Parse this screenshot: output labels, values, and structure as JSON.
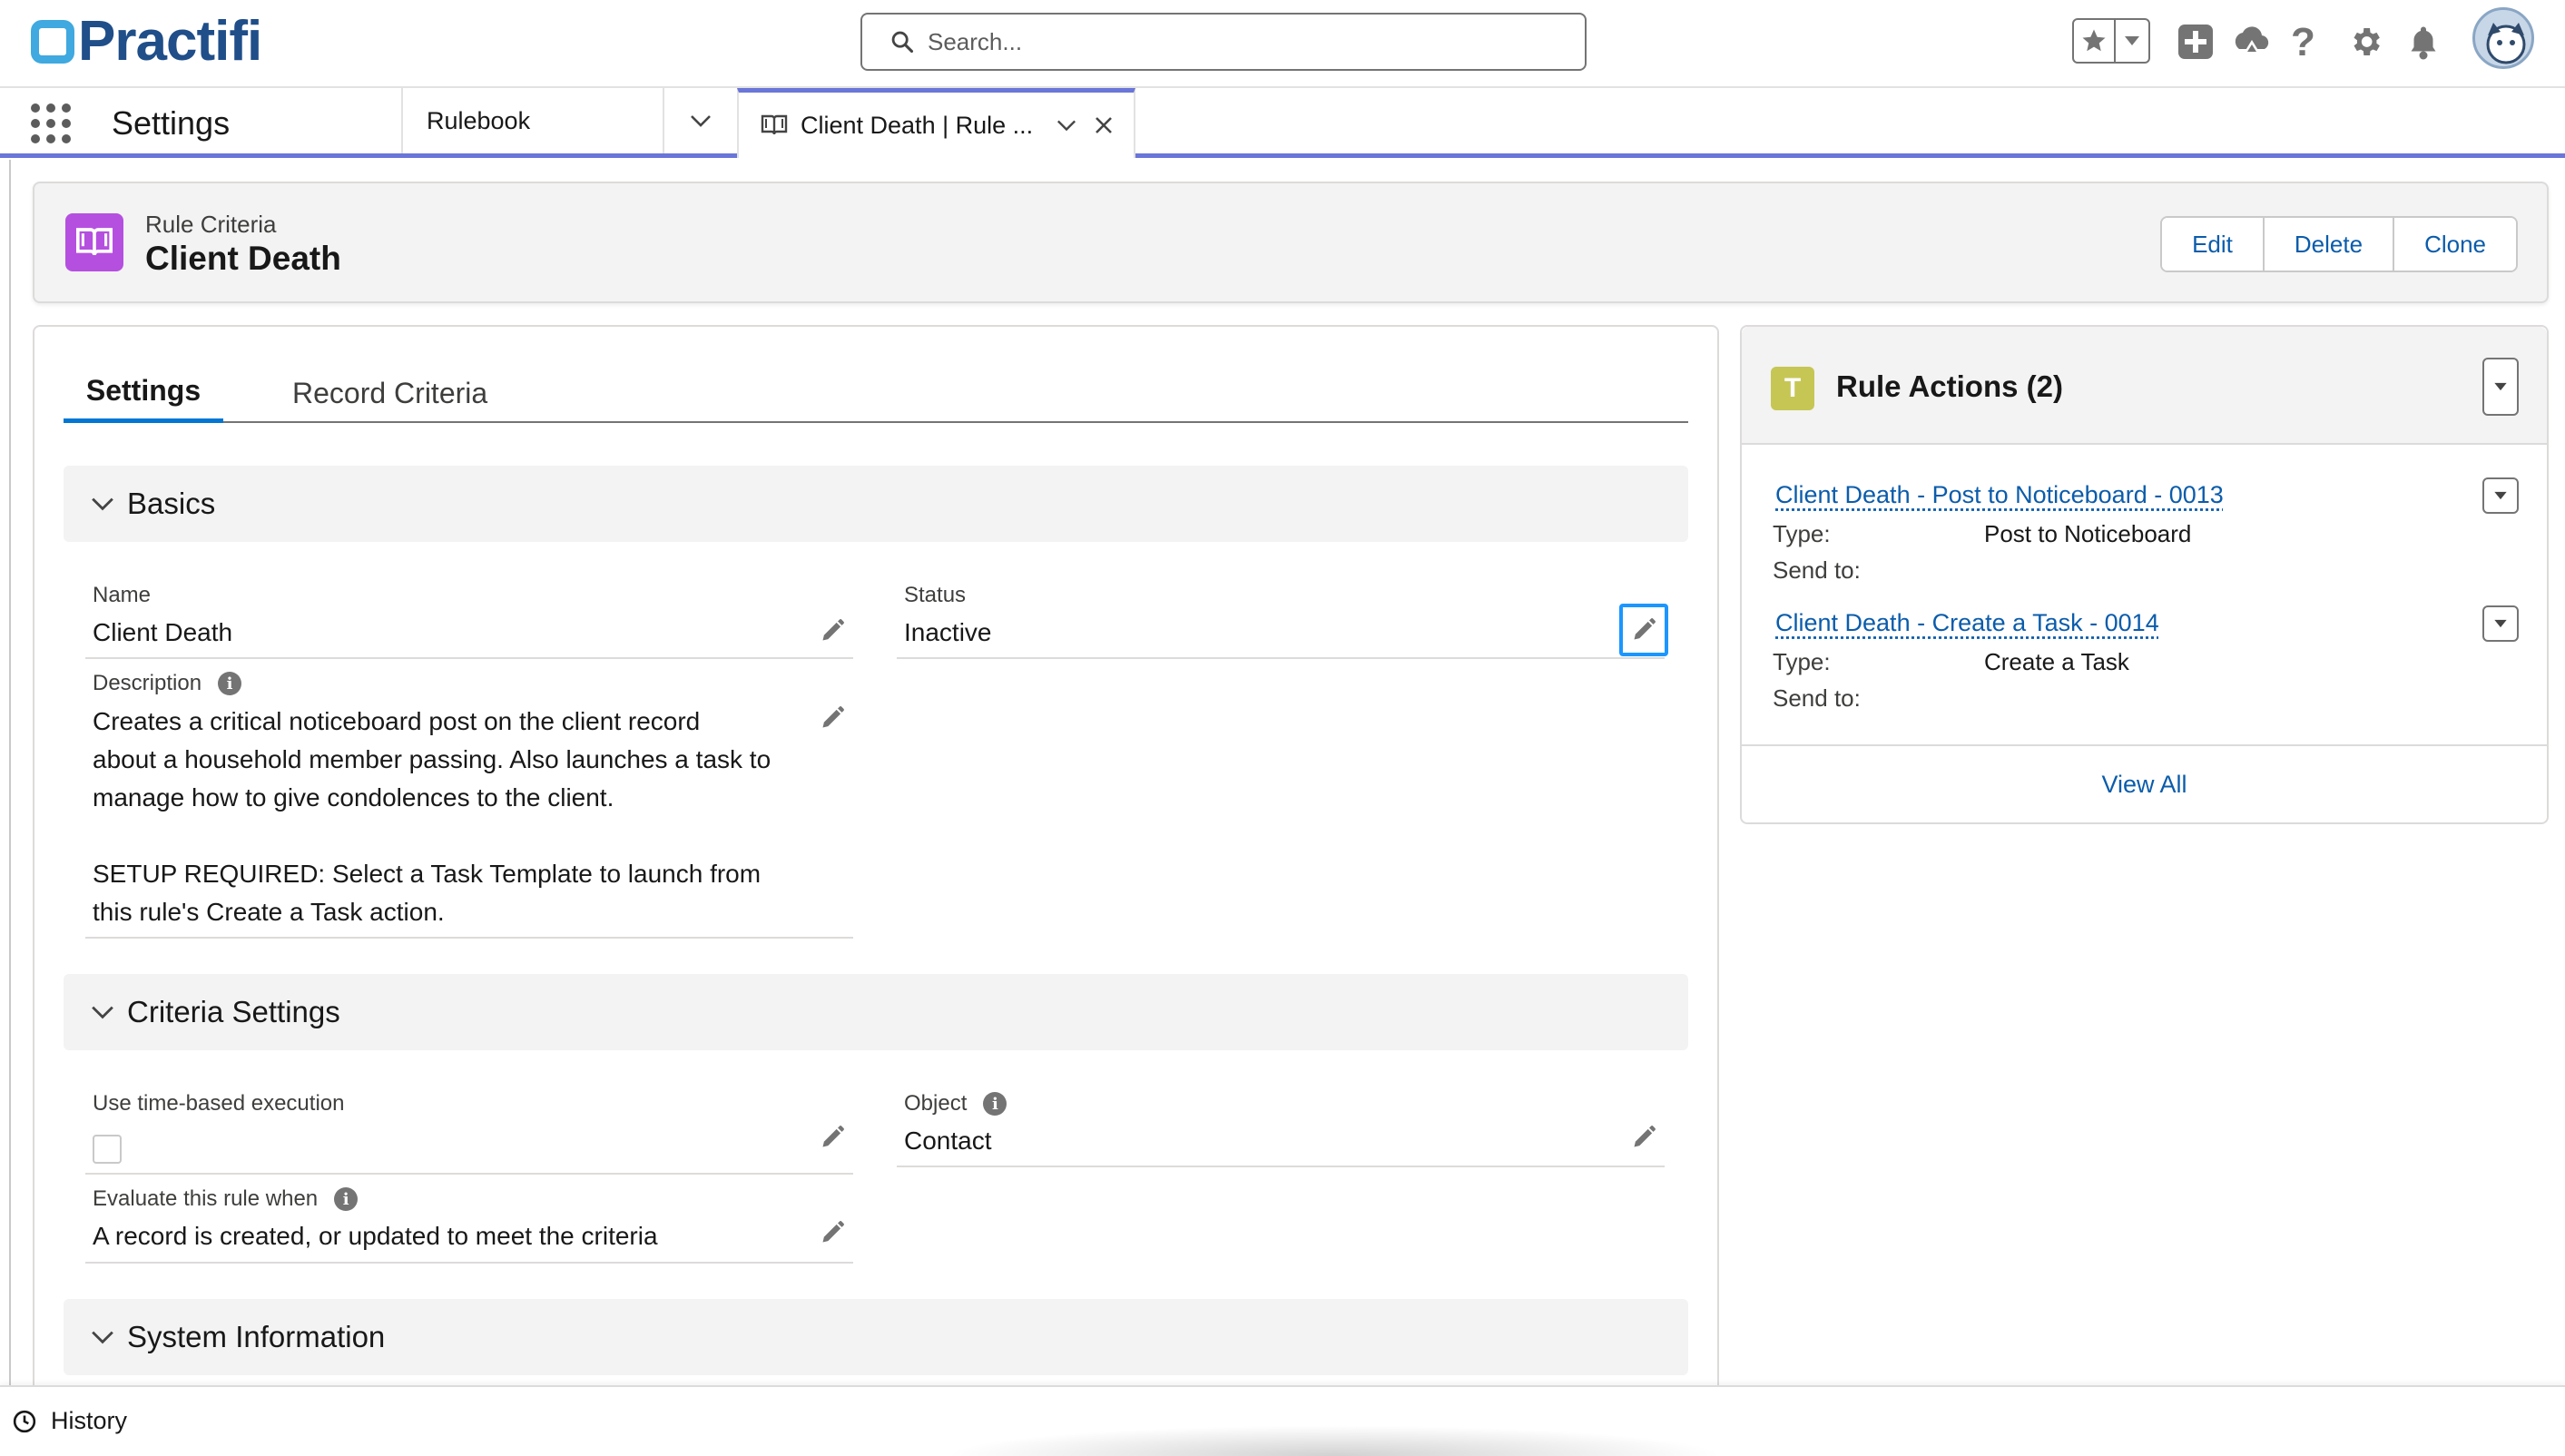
{
  "brand": {
    "name": "Practifi"
  },
  "search": {
    "placeholder": "Search..."
  },
  "header_icons": [
    "favorites-star-icon",
    "favorites-dropdown-icon",
    "global-actions-add-icon",
    "trailhead-icon",
    "help-icon",
    "setup-gear-icon",
    "notifications-bell-icon",
    "user-avatar"
  ],
  "nav": {
    "app_name": "Settings",
    "tabs": [
      {
        "label": "Rulebook"
      },
      {
        "label": "Client Death | Rule ..."
      }
    ]
  },
  "record": {
    "type_label": "Rule Criteria",
    "title": "Client Death",
    "actions": {
      "edit": "Edit",
      "delete": "Delete",
      "clone": "Clone"
    }
  },
  "detail_tabs": {
    "settings": "Settings",
    "record_criteria": "Record Criteria"
  },
  "sections": {
    "basics": {
      "title": "Basics",
      "name_label": "Name",
      "name_value": "Client Death",
      "status_label": "Status",
      "status_value": "Inactive",
      "description_label": "Description",
      "description_lines": [
        "Creates a critical noticeboard post on the client record",
        "about a household member passing. Also launches a task to",
        "manage how to give condolences to the client.",
        "SETUP REQUIRED: Select a Task Template to launch from",
        "this rule's Create a Task action."
      ]
    },
    "criteria": {
      "title": "Criteria Settings",
      "time_based_label": "Use time-based execution",
      "time_based_checked": false,
      "object_label": "Object",
      "object_value": "Contact",
      "evaluate_label": "Evaluate this rule when",
      "evaluate_value": "A record is created, or updated to meet the criteria"
    },
    "system": {
      "title": "System Information"
    }
  },
  "rule_actions": {
    "title": "Rule Actions (2)",
    "type_label": "Type:",
    "send_to_label": "Send to:",
    "items": [
      {
        "name": "Client Death - Post to Noticeboard - 0013",
        "type": "Post to Noticeboard",
        "send_to": ""
      },
      {
        "name": "Client Death - Create a Task - 0014",
        "type": "Create a Task",
        "send_to": ""
      }
    ],
    "view_all": "View All"
  },
  "utility_bar": {
    "history": "History"
  },
  "colors": {
    "brand": "#1f4e89",
    "accent": "#0176d3",
    "nav_border": "#6a76d8",
    "object_icon": "#b54fe0",
    "action_icon": "#c6c655"
  }
}
